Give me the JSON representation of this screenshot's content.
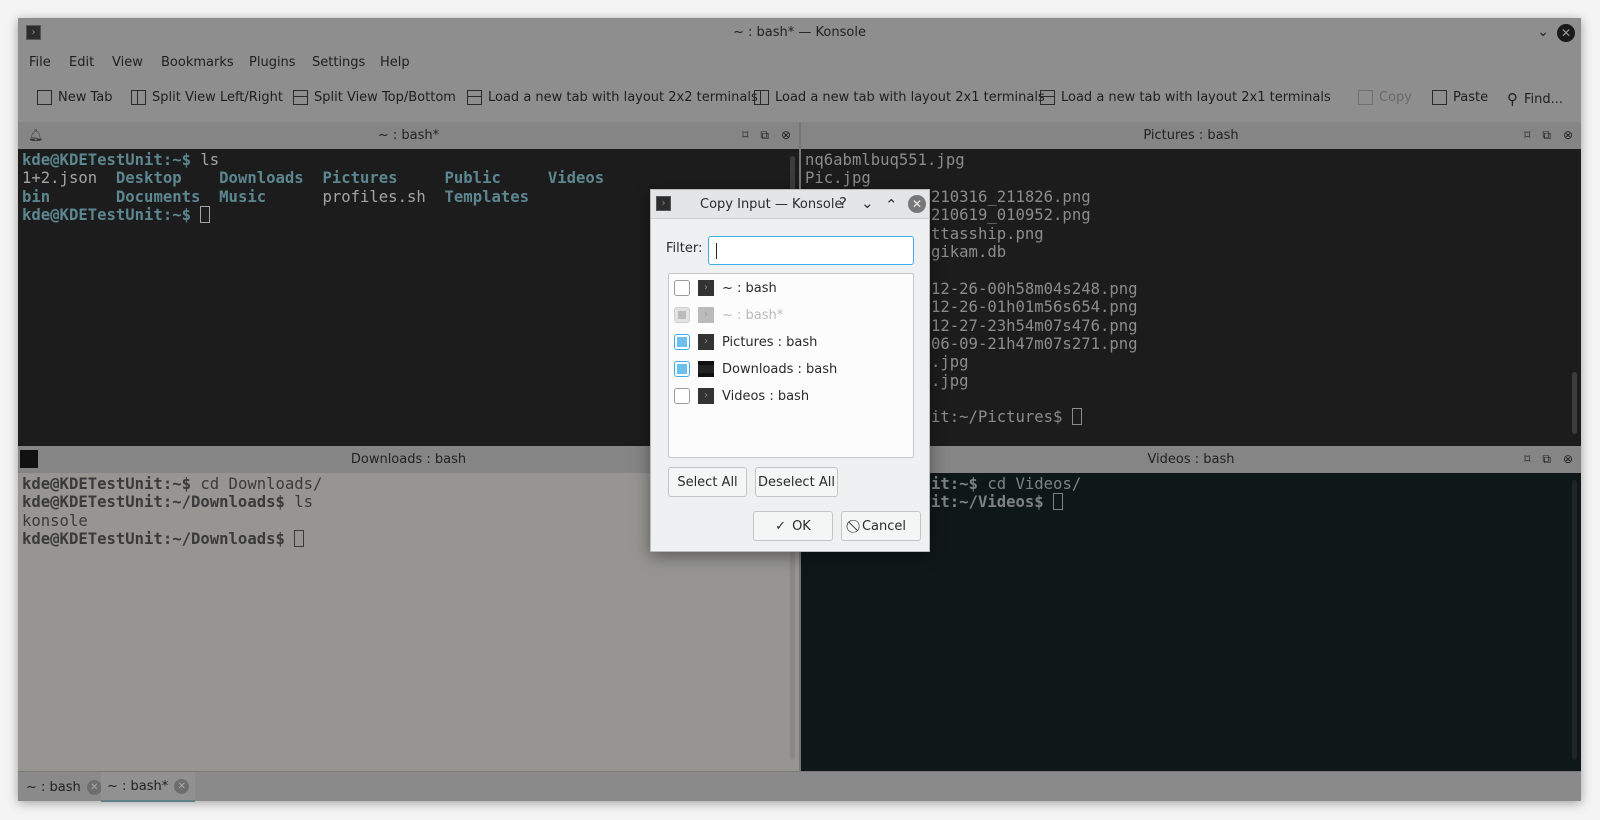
{
  "window": {
    "title": "~ : bash* — Konsole"
  },
  "menu": [
    "File",
    "Edit",
    "View",
    "Bookmarks",
    "Plugins",
    "Settings",
    "Help"
  ],
  "toolbar": [
    {
      "label": "New Tab",
      "icon": "new-tab-icon"
    },
    {
      "label": "Split View Left/Right",
      "icon": "split-left-right-icon"
    },
    {
      "label": "Split View Top/Bottom",
      "icon": "split-top-bottom-icon"
    },
    {
      "label": "Load a new tab with layout 2x2 terminals",
      "icon": "layout-2x2-icon"
    },
    {
      "label": "Load a new tab with layout 2x1 terminals",
      "icon": "layout-2x1-icon"
    },
    {
      "label": "Load a new tab with layout 2x1 terminals",
      "icon": "layout-2x1-icon"
    },
    {
      "label": "Copy",
      "icon": "copy-icon",
      "disabled": true
    },
    {
      "label": "Paste",
      "icon": "paste-icon"
    },
    {
      "label": "Find...",
      "icon": "search-icon"
    }
  ],
  "panes": [
    {
      "title": "~ : bash*",
      "lines": [
        [
          {
            "t": "kde@KDETestUnit:~$ ",
            "c": "prompt"
          },
          {
            "t": "ls",
            "c": ""
          }
        ],
        [
          {
            "t": "1+2.json  ",
            "c": ""
          },
          {
            "t": "Desktop",
            "c": "dir"
          },
          {
            "t": "    ",
            "c": ""
          },
          {
            "t": "Downloads",
            "c": "dir"
          },
          {
            "t": "  ",
            "c": ""
          },
          {
            "t": "Pictures",
            "c": "dir"
          },
          {
            "t": "     ",
            "c": ""
          },
          {
            "t": "Public",
            "c": "dir"
          },
          {
            "t": "     ",
            "c": ""
          },
          {
            "t": "Videos",
            "c": "dir"
          }
        ],
        [
          {
            "t": "bin",
            "c": "dir"
          },
          {
            "t": "       ",
            "c": ""
          },
          {
            "t": "Documents",
            "c": "dir"
          },
          {
            "t": "  ",
            "c": ""
          },
          {
            "t": "Music",
            "c": "dir"
          },
          {
            "t": "      ",
            "c": ""
          },
          {
            "t": "profiles.sh",
            "c": ""
          },
          {
            "t": "  ",
            "c": ""
          },
          {
            "t": "Templates",
            "c": "dir"
          }
        ],
        [
          {
            "t": "kde@KDETestUnit:~$ ",
            "c": "prompt"
          },
          {
            "t": "",
            "c": "cursor"
          }
        ]
      ]
    },
    {
      "title": "Pictures : bash",
      "lines": [
        [
          {
            "t": "nq6abmlbuq551.jpg",
            "c": ""
          }
        ],
        [
          {
            "t": "Pic.jpg",
            "c": ""
          }
        ],
        [
          {
            "t": "210316_211826.png",
            "c": "",
            "p": true
          }
        ],
        [
          {
            "t": "210619_010952.png",
            "c": "",
            "p": true
          }
        ],
        [
          {
            "t": "ttasship.png",
            "c": "",
            "p": true
          }
        ],
        [
          {
            "t": "gikam.db",
            "c": "",
            "p": true
          }
        ],
        [
          {
            "t": "",
            "c": ""
          }
        ],
        [
          {
            "t": "12-26-00h58m04s248.png",
            "c": "",
            "p": true
          }
        ],
        [
          {
            "t": "12-26-01h01m56s654.png",
            "c": "",
            "p": true
          }
        ],
        [
          {
            "t": "12-27-23h54m07s476.png",
            "c": "",
            "p": true
          }
        ],
        [
          {
            "t": "06-09-21h47m07s271.png",
            "c": "",
            "p": true
          }
        ],
        [
          {
            "t": ".jpg",
            "c": "",
            "p": true
          }
        ],
        [
          {
            "t": ".jpg",
            "c": "",
            "p": true
          }
        ],
        [
          {
            "t": "",
            "c": ""
          }
        ],
        [
          {
            "t": "it:~/Pictures$ ",
            "c": "prompt",
            "p": true
          },
          {
            "t": "",
            "c": "cursor"
          }
        ]
      ]
    },
    {
      "title": "Downloads : bash",
      "lines": [
        [
          {
            "t": "kde@KDETestUnit:~$ ",
            "c": "prompt"
          },
          {
            "t": "cd Downloads/",
            "c": ""
          }
        ],
        [
          {
            "t": "kde@KDETestUnit:~/Downloads$ ",
            "c": "prompt"
          },
          {
            "t": "ls",
            "c": ""
          }
        ],
        [
          {
            "t": "konsole",
            "c": ""
          }
        ],
        [
          {
            "t": "kde@KDETestUnit:~/Downloads$ ",
            "c": "prompt"
          },
          {
            "t": "",
            "c": "cursor"
          }
        ]
      ]
    },
    {
      "title": "Videos : bash",
      "lines": [
        [
          {
            "t": "it:~$ ",
            "c": "prompt",
            "p": true
          },
          {
            "t": "cd Videos/",
            "c": ""
          }
        ],
        [
          {
            "t": "it:~/Videos$ ",
            "c": "prompt",
            "p": true
          },
          {
            "t": "",
            "c": "cursor"
          }
        ]
      ]
    }
  ],
  "tabs": [
    {
      "label": "~ : bash"
    },
    {
      "label": "~ : bash*",
      "active": true
    }
  ],
  "dialog": {
    "title": "Copy Input — Konsole",
    "help": "?",
    "close": "✕",
    "filter_label": "Filter:",
    "filter_value": "",
    "items": [
      {
        "label": "~ : bash",
        "checked": false,
        "disabled": false
      },
      {
        "label": "~ : bash*",
        "checked": false,
        "disabled": true
      },
      {
        "label": "Pictures : bash",
        "checked": true,
        "disabled": false
      },
      {
        "label": "Downloads : bash",
        "checked": true,
        "disabled": false
      },
      {
        "label": "Videos : bash",
        "checked": false,
        "disabled": false
      }
    ],
    "select_all": "Select All",
    "deselect_all": "Deselect All",
    "ok": "OK",
    "cancel": "Cancel"
  }
}
